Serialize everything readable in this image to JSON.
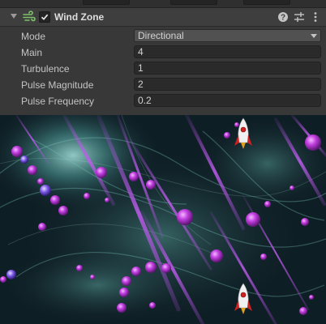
{
  "component": {
    "title": "Wind Zone",
    "enabled": true,
    "icons": [
      "wind-zone-icon",
      "help-icon",
      "preset-icon",
      "more-options-icon"
    ]
  },
  "properties": [
    {
      "label": "Mode",
      "value": "Directional",
      "kind": "dropdown"
    },
    {
      "label": "Main",
      "value": "4",
      "kind": "number"
    },
    {
      "label": "Turbulence",
      "value": "1",
      "kind": "number"
    },
    {
      "label": "Pulse Magnitude",
      "value": "2",
      "kind": "number"
    },
    {
      "label": "Pulse Frequency",
      "value": "0.2",
      "kind": "number"
    }
  ],
  "game_view": {
    "scene": "space nebula with purple particle streaks, purple orbs and two white-and-red rockets",
    "colors": {
      "background": "#0d1d24",
      "nebula": "#5fa8a0",
      "streak": "#b04be0",
      "orb": "#c23ee0",
      "rocket_body": "#f0f0f0",
      "rocket_accent": "#d02020"
    }
  }
}
